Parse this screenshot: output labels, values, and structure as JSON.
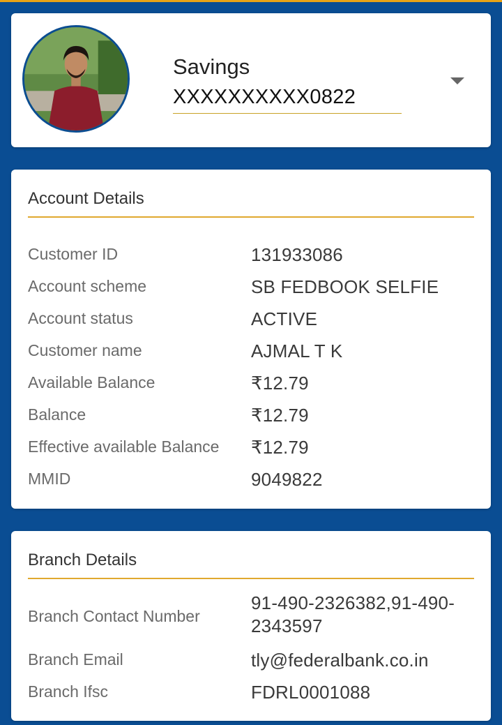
{
  "colors": {
    "background": "#0a4d93",
    "accent": "#e0a82e",
    "card": "#ffffff"
  },
  "account_selector": {
    "type": "Savings",
    "number": "XXXXXXXXXX0822",
    "dropdown_icon": "caret-down-icon",
    "avatar_icon": "profile-photo"
  },
  "account_details": {
    "title": "Account Details",
    "rows": [
      {
        "label": "Customer ID",
        "value": "131933086"
      },
      {
        "label": "Account scheme",
        "value": "SB FEDBOOK SELFIE"
      },
      {
        "label": "Account status",
        "value": "ACTIVE"
      },
      {
        "label": "Customer name",
        "value": "AJMAL T K"
      },
      {
        "label": "Available Balance",
        "value": "₹12.79"
      },
      {
        "label": "Balance",
        "value": "₹12.79"
      },
      {
        "label": "Effective available Balance",
        "value": "₹12.79"
      },
      {
        "label": "MMID",
        "value": "9049822"
      }
    ]
  },
  "branch_details": {
    "title": "Branch Details",
    "rows": [
      {
        "label": "Branch Contact Number",
        "value": "91-490-2326382,91-490-2343597"
      },
      {
        "label": "Branch Email",
        "value": "tly@federalbank.co.in"
      },
      {
        "label": "Branch Ifsc",
        "value": "FDRL0001088"
      }
    ]
  }
}
